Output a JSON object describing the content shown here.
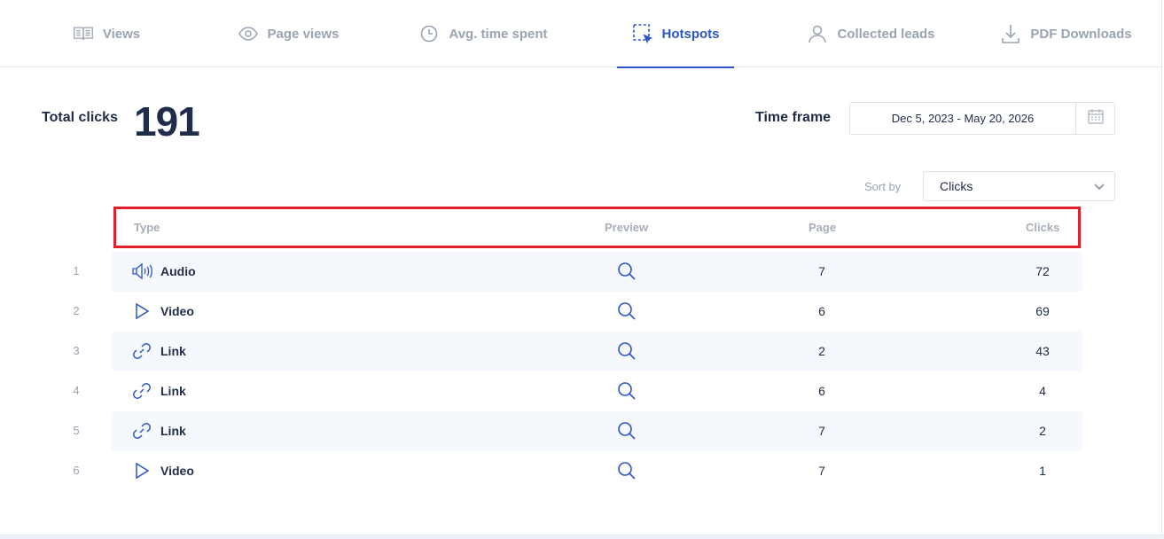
{
  "tabs": [
    {
      "label": "Views",
      "icon": "book-icon",
      "active": false
    },
    {
      "label": "Page views",
      "icon": "eye-icon",
      "active": false
    },
    {
      "label": "Avg. time spent",
      "icon": "clock-icon",
      "active": false
    },
    {
      "label": "Hotspots",
      "icon": "hotspot-select-icon",
      "active": true
    },
    {
      "label": "Collected leads",
      "icon": "user-icon",
      "active": false
    },
    {
      "label": "PDF Downloads",
      "icon": "download-icon",
      "active": false
    }
  ],
  "summary": {
    "total_clicks_label": "Total clicks",
    "total_clicks_value": "191"
  },
  "timeframe": {
    "label": "Time frame",
    "value": "Dec 5, 2023 - May 20, 2026"
  },
  "sort": {
    "label": "Sort by",
    "selected": "Clicks"
  },
  "table": {
    "headers": {
      "type": "Type",
      "preview": "Preview",
      "page": "Page",
      "clicks": "Clicks"
    },
    "rows": [
      {
        "rank": "1",
        "type": "Audio",
        "icon": "audio-icon",
        "page": "7",
        "clicks": "72"
      },
      {
        "rank": "2",
        "type": "Video",
        "icon": "play-icon",
        "page": "6",
        "clicks": "69"
      },
      {
        "rank": "3",
        "type": "Link",
        "icon": "link-icon",
        "page": "2",
        "clicks": "43"
      },
      {
        "rank": "4",
        "type": "Link",
        "icon": "link-icon",
        "page": "6",
        "clicks": "4"
      },
      {
        "rank": "5",
        "type": "Link",
        "icon": "link-icon",
        "page": "7",
        "clicks": "2"
      },
      {
        "rank": "6",
        "type": "Video",
        "icon": "play-icon",
        "page": "7",
        "clicks": "1"
      }
    ]
  },
  "colors": {
    "accent": "#2a56c6",
    "text": "#1f2d4a",
    "muted": "#9aa3b2",
    "highlight": "#e0202a",
    "stripe": "#f5f8fc"
  }
}
